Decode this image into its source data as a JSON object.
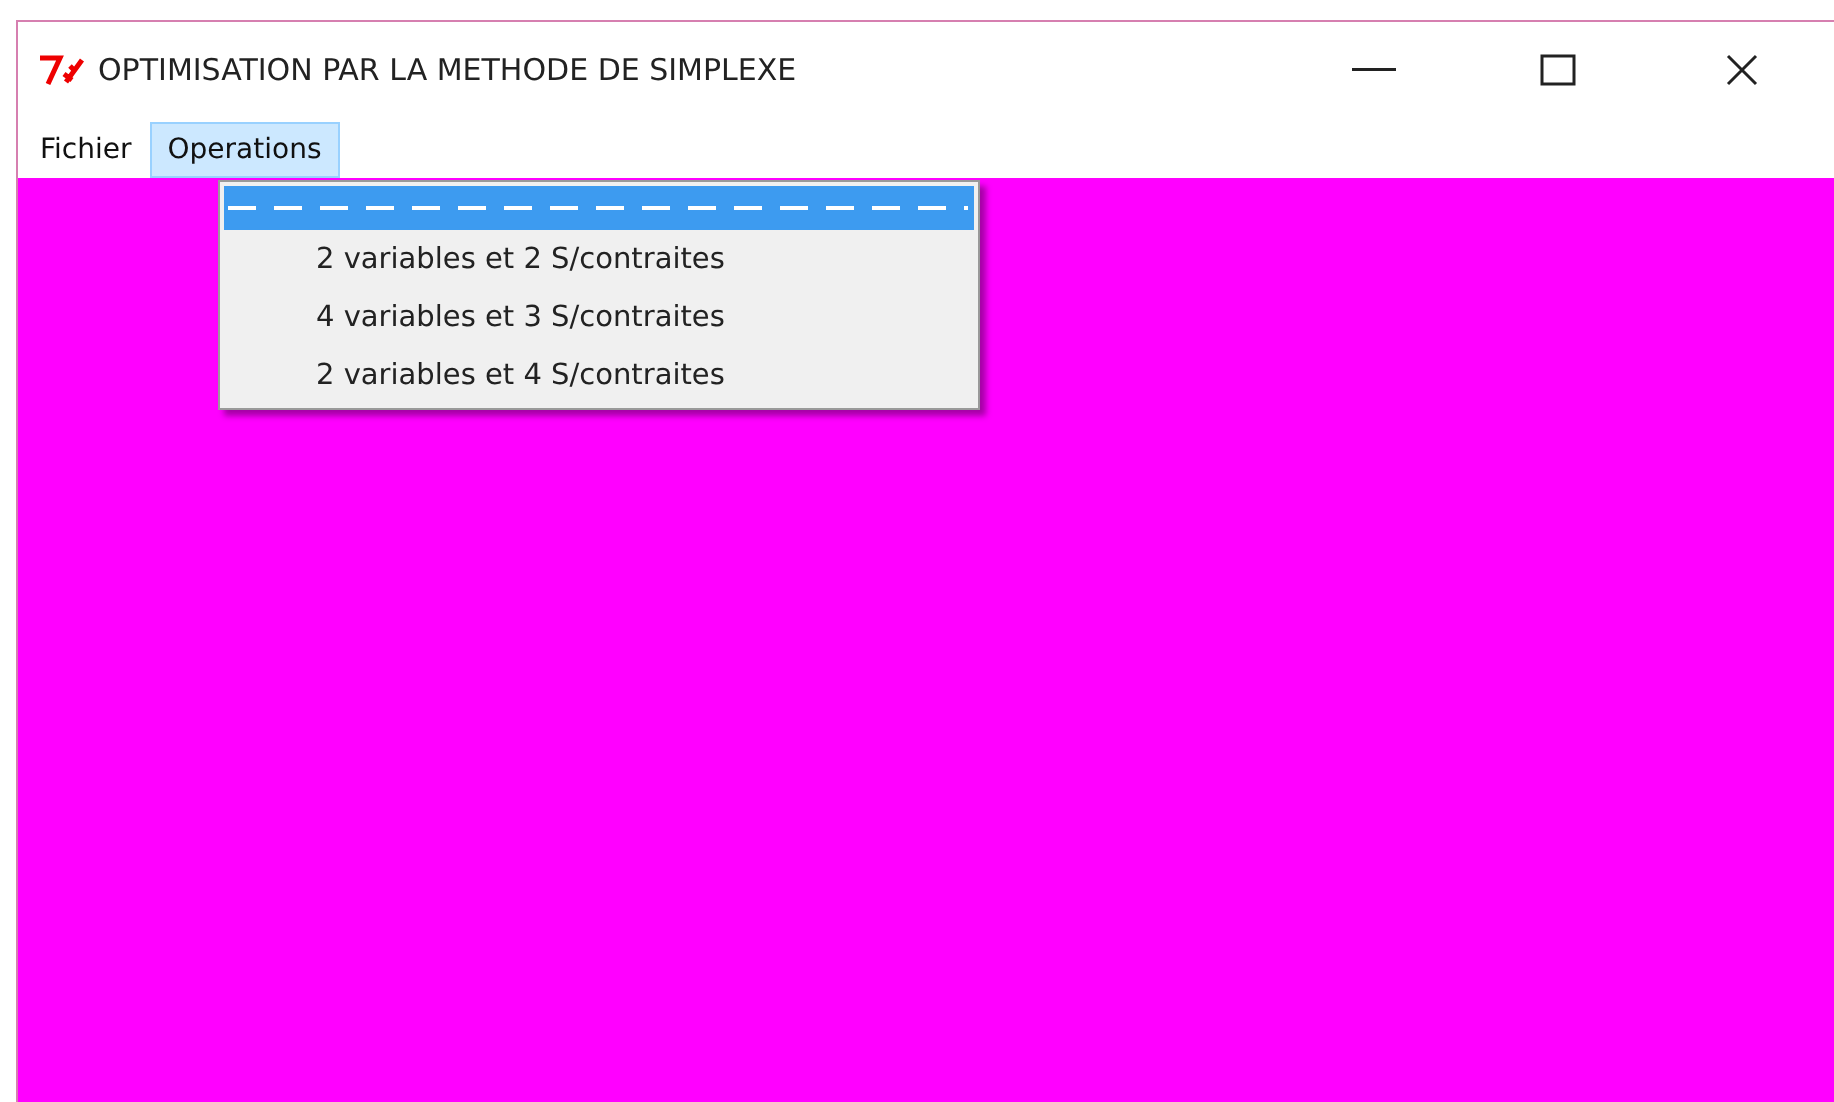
{
  "window": {
    "title": "OPTIMISATION PAR LA METHODE DE SIMPLEXE"
  },
  "menu_bar": [
    {
      "label": "Fichier",
      "selected": false
    },
    {
      "label": "Operations",
      "selected": true
    }
  ],
  "dropdown": {
    "tearoff_selected": true,
    "items": [
      {
        "label": "2 variables et 2 S/contraites",
        "selected": false
      },
      {
        "label": "4 variables et 3 S/contraites",
        "selected": false
      },
      {
        "label": "2 variables et 4 S/contraites",
        "selected": false
      }
    ]
  }
}
